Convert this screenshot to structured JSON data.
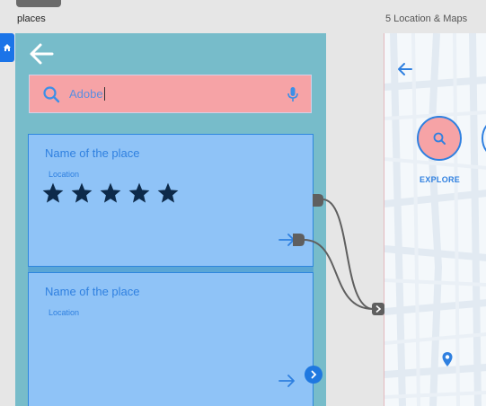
{
  "artboards": [
    {
      "title": "places"
    },
    {
      "title": "5 Location & Maps"
    }
  ],
  "search": {
    "value": "Adobe"
  },
  "cards": [
    {
      "title": "Name of the place",
      "location": "Location",
      "stars": 5
    },
    {
      "title": "Name of the place",
      "location": "Location"
    }
  ],
  "map": {
    "explore_label": "EXPLORE"
  },
  "icons": {
    "home": "home-icon",
    "back": "arrow-left-icon",
    "search": "search-icon",
    "mic": "microphone-icon",
    "star": "star-icon",
    "arrow": "arrow-right-icon",
    "chevron": "chevron-right-icon",
    "pin": "map-pin-icon"
  },
  "colors": {
    "artboard_bg": "#77bcca",
    "search_bg": "#f6a3a6",
    "card_bg": "#8fc3f7",
    "accent": "#2f80e0",
    "star": "#0d2a4a",
    "wire": "#5f5f5f"
  }
}
